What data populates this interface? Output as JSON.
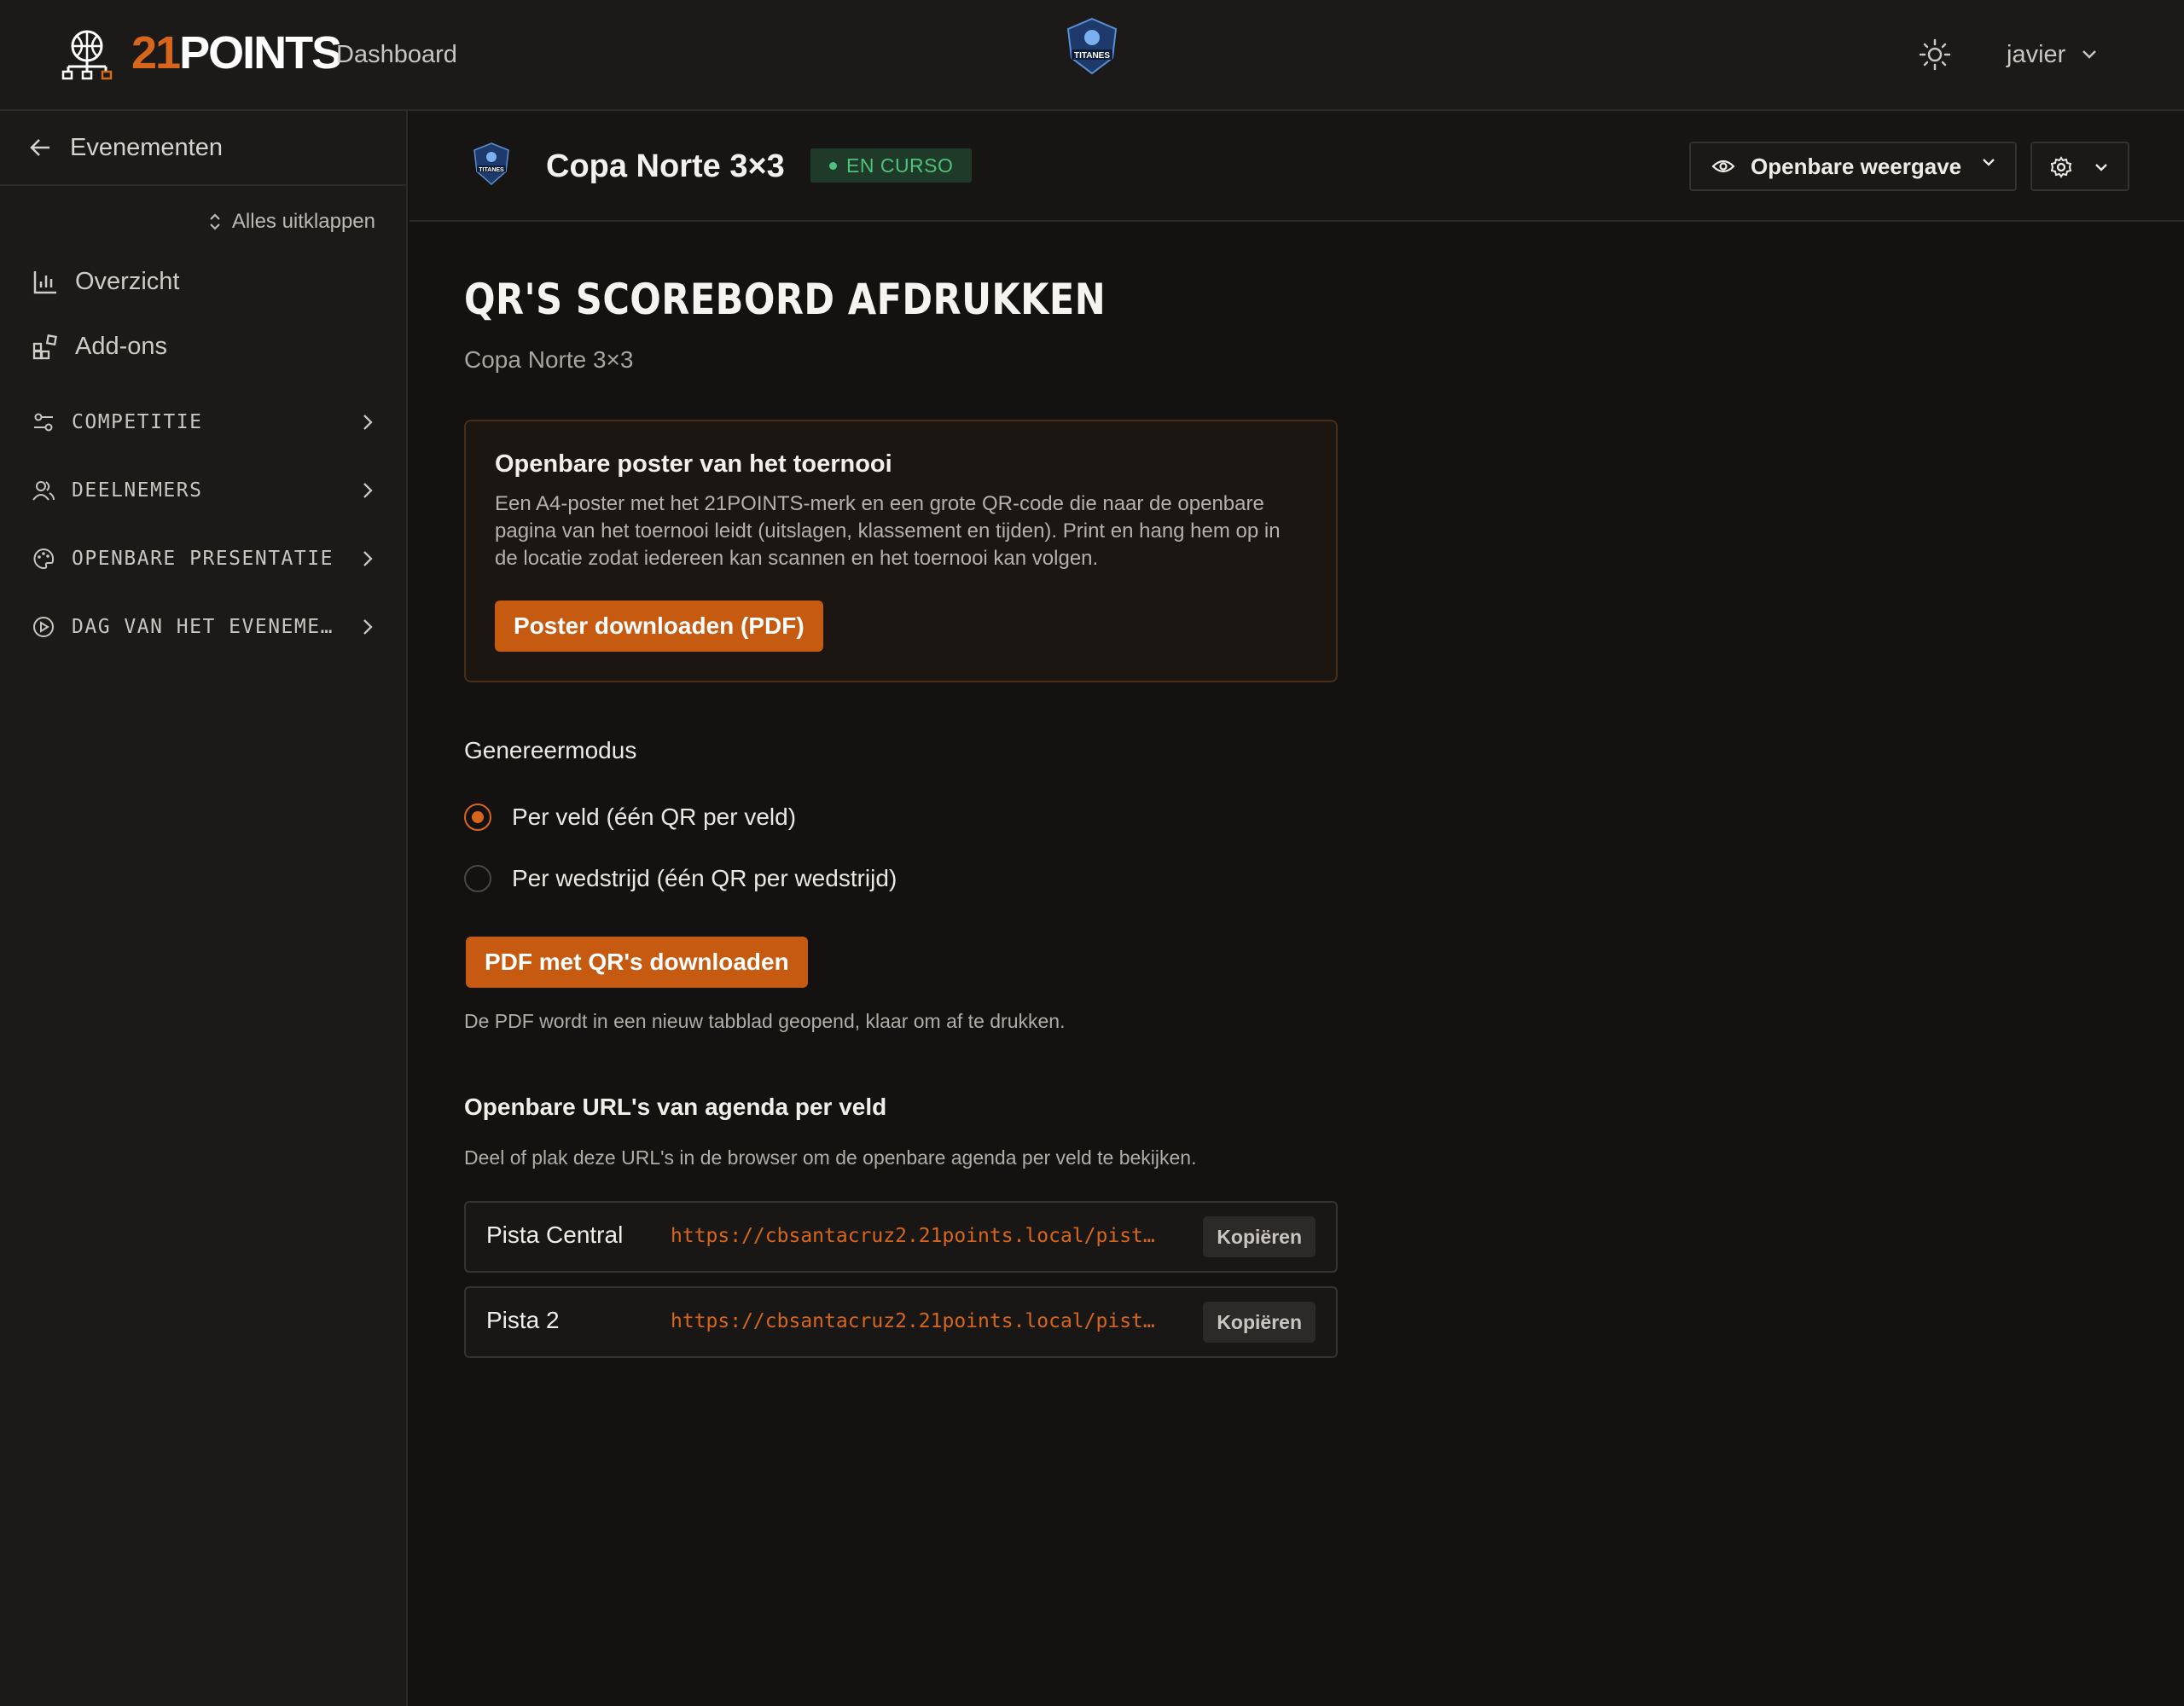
{
  "topbar": {
    "brand_part1": "21",
    "brand_part2": "POINTS",
    "nav_dashboard": "Dashboard",
    "user_name": "javier",
    "icons": [
      "basketball-logo-icon",
      "team-logo",
      "sun-icon",
      "chevron-down-icon"
    ]
  },
  "sidebar": {
    "back_label": "Evenementen",
    "collapse_label": "Alles uitklappen",
    "items": [
      {
        "label": "Overzicht",
        "icon": "bar-chart-icon"
      },
      {
        "label": "Add-ons",
        "icon": "addons-icon"
      }
    ],
    "sections": [
      {
        "label": "COMPETITIE",
        "icon": "sliders-icon"
      },
      {
        "label": "DEELNEMERS",
        "icon": "users-icon"
      },
      {
        "label": "OPENBARE PRESENTATIE",
        "icon": "palette-icon"
      },
      {
        "label": "DAG VAN HET EVENEME…",
        "icon": "play-circle-icon"
      }
    ]
  },
  "event": {
    "title": "Copa Norte 3×3",
    "status": "EN CURSO",
    "public_view_label": "Openbare weergave"
  },
  "main": {
    "title": "QR'S SCOREBORD AFDRUKKEN",
    "subtitle": "Copa Norte 3×3",
    "poster": {
      "title": "Openbare poster van het toernooi",
      "description": "Een A4-poster met het 21POINTS-merk en een grote QR-code die naar de openbare pagina van het toernooi leidt (uitslagen, klassement en tijden). Print en hang hem op in de locatie zodat iedereen kan scannen en het toernooi kan volgen.",
      "button": "Poster downloaden (PDF)"
    },
    "mode_label": "Genereermodus",
    "modes": [
      {
        "label": "Per veld (één QR per veld)",
        "selected": true
      },
      {
        "label": "Per wedstrijd (één QR per wedstrijd)",
        "selected": false
      }
    ],
    "pdf_button": "PDF met QR's downloaden",
    "pdf_note": "De PDF wordt in een nieuw tabblad geopend, klaar om af te drukken.",
    "urls_title": "Openbare URL's van agenda per veld",
    "urls_description": "Deel of plak deze URL's in de browser om de openbare agenda per veld te bekijken.",
    "urls": [
      {
        "name": "Pista Central",
        "url": "https://cbsantacruz2.21points.local/pist…",
        "copy": "Kopiëren"
      },
      {
        "name": "Pista 2",
        "url": "https://cbsantacruz2.21points.local/pist…",
        "copy": "Kopiëren"
      }
    ]
  },
  "colors": {
    "accent": "#d8661a",
    "background": "#131211",
    "panel": "#1b1a19",
    "status_green": "#4ec27a"
  }
}
